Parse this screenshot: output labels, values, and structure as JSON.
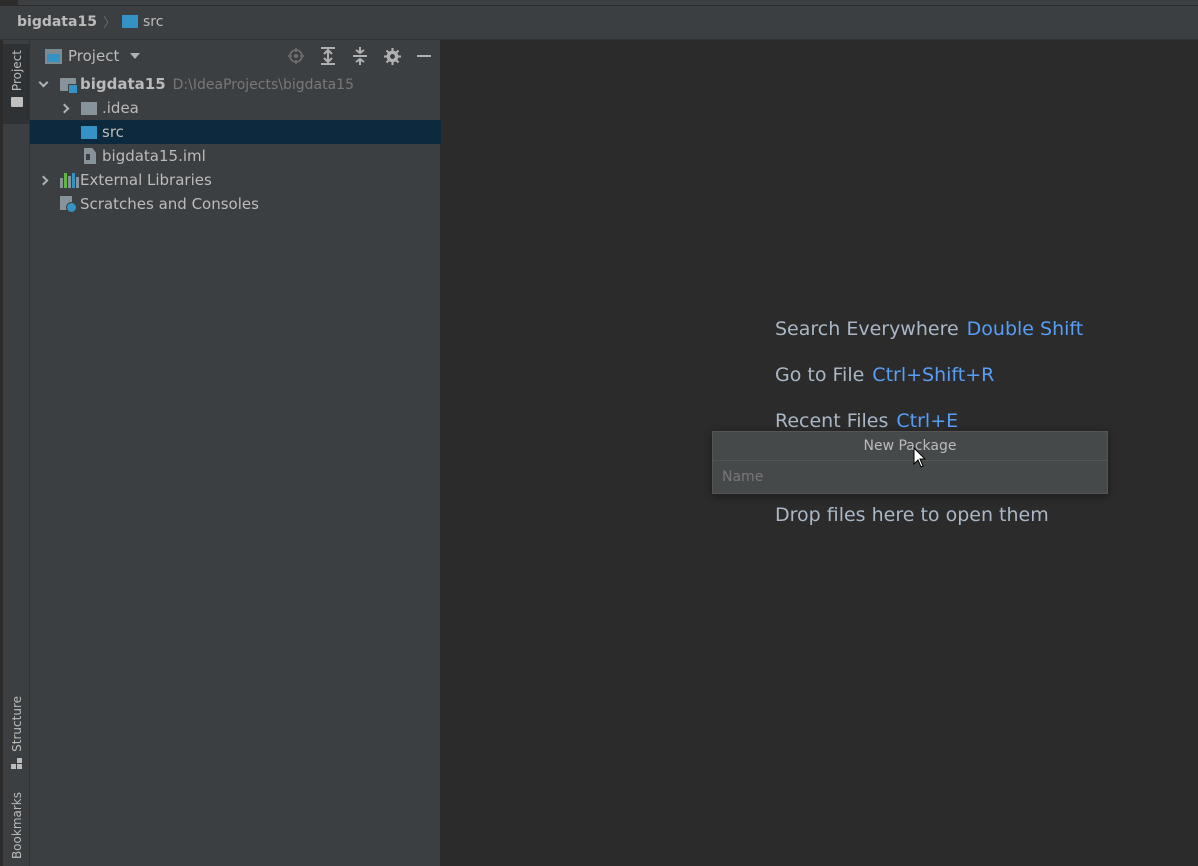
{
  "navbar": {
    "project": "bigdata15",
    "separator": "〉",
    "folder": "src"
  },
  "side_strip": {
    "project_tab": "Project",
    "structure_tab": "Structure",
    "bookmarks_tab": "Bookmarks"
  },
  "project_panel": {
    "view_label": "Project",
    "tools": [
      "locate-icon",
      "expand-all-icon",
      "collapse-all-icon",
      "gear-icon",
      "minimize-icon"
    ],
    "tree": {
      "root": {
        "label": "bigdata15",
        "path": "D:\\IdeaProjects\\bigdata15"
      },
      "idea": ".idea",
      "src": "src",
      "iml": "bigdata15.iml",
      "external_libraries": "External Libraries",
      "scratches": "Scratches and Consoles"
    }
  },
  "editor_hints": {
    "search_everywhere": {
      "label": "Search Everywhere",
      "shortcut": "Double Shift"
    },
    "go_to_file": {
      "label": "Go to File",
      "shortcut": "Ctrl+Shift+R"
    },
    "recent_files": {
      "label": "Recent Files",
      "shortcut": "Ctrl+E"
    },
    "drop_files": "Drop files here to open them"
  },
  "new_package_popup": {
    "title": "New Package",
    "input_value": "",
    "input_placeholder": "Name"
  },
  "colors": {
    "accent_blue": "#589df6",
    "folder_blue": "#3592c4",
    "selection": "#0d293e"
  }
}
